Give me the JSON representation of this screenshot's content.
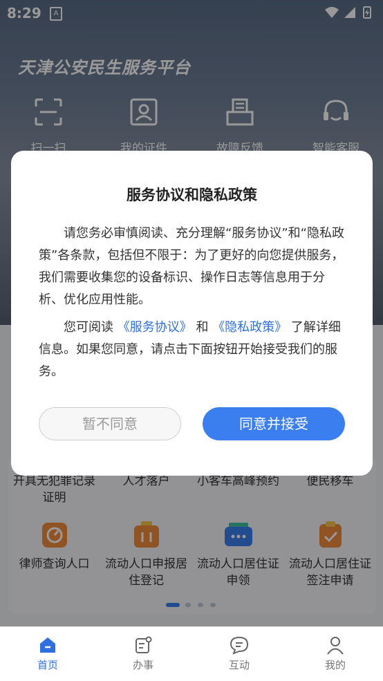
{
  "status": {
    "time": "8:29",
    "a_icon": "A"
  },
  "brand": "天津公安民生服务平台",
  "quick_actions": [
    {
      "label": "扫一扫",
      "icon": "scan-icon"
    },
    {
      "label": "我的证件",
      "icon": "id-card-icon"
    },
    {
      "label": "故障反馈",
      "icon": "feedback-icon"
    },
    {
      "label": "智能客服",
      "icon": "headset-icon"
    }
  ],
  "services_row1": [
    {
      "label": "开具无犯罪记录证明"
    },
    {
      "label": "人才落户"
    },
    {
      "label": "小客车高峰预约"
    },
    {
      "label": "便民移车"
    }
  ],
  "services_row2": [
    {
      "label": "律师查询人口",
      "icon": "lawyer-icon",
      "color": "#f08a3c"
    },
    {
      "label": "流动人口申报居住登记",
      "icon": "briefcase-icon",
      "color": "#f08a3c"
    },
    {
      "label": "流动人口居住证申领",
      "icon": "card-icon",
      "color": "#3b7ef0"
    },
    {
      "label": "流动人口居住证签注申请",
      "icon": "clipboard-check-icon",
      "color": "#f08a3c"
    }
  ],
  "dialog": {
    "title": "服务协议和隐私政策",
    "para1": "请您务必审慎阅读、充分理解“服务协议”和“隐私政策”各条款，包括但不限于：为了更好的向您提供服务，我们需要收集您的设备标识、操作日志等信息用于分析、优化应用性能。",
    "para2_prefix": "您可阅读 ",
    "link_service": "《服务协议》",
    "para2_and": " 和 ",
    "link_privacy": "《隐私政策》",
    "para2_suffix": " 了解详细信息。如果您同意，请点击下面按钮开始接受我们的服务。",
    "decline_label": "暂不同意",
    "accept_label": "同意并接受"
  },
  "nav": [
    {
      "label": "首页",
      "icon": "home-icon",
      "active": true
    },
    {
      "label": "办事",
      "icon": "task-icon",
      "active": false
    },
    {
      "label": "互动",
      "icon": "chat-icon",
      "active": false
    },
    {
      "label": "我的",
      "icon": "user-icon",
      "active": false
    }
  ],
  "colors": {
    "accent": "#3b7ef0",
    "orange": "#f08a3c"
  }
}
